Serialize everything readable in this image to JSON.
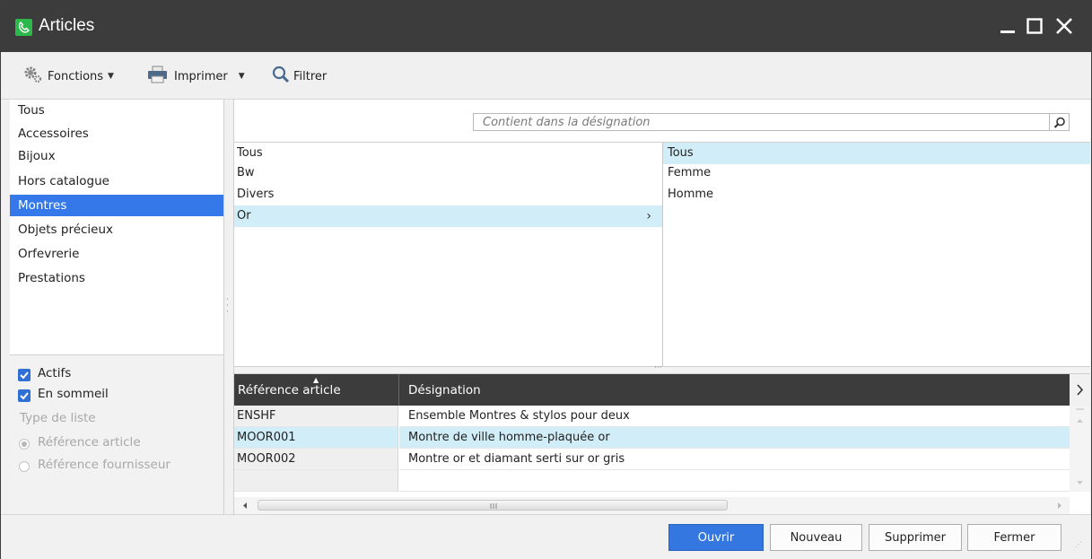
{
  "window": {
    "title": "Articles"
  },
  "toolbar": {
    "fonctions_label": "Fonctions",
    "imprimer_label": "Imprimer",
    "filtrer_label": "Filtrer"
  },
  "categories": [
    "Tous",
    "Accessoires",
    "Bijoux",
    "Hors catalogue",
    "Montres",
    "Objets précieux",
    "Orfevrerie",
    "Prestations"
  ],
  "selected_category": "Montres",
  "options": {
    "actifs_label": "Actifs",
    "actifs_checked": true,
    "en_sommeil_label": "En sommeil",
    "en_sommeil_checked": true,
    "type_liste_label": "Type de liste",
    "radio_ref_article": "Référence article",
    "radio_ref_fournisseur": "Référence fournisseur"
  },
  "search": {
    "placeholder": "Contient dans la désignation"
  },
  "list_left": [
    "Tous",
    "Bw",
    "Divers",
    "Or"
  ],
  "list_right": [
    "Tous",
    "Femme",
    "Homme"
  ],
  "grid": {
    "columns": [
      "Référence article",
      "Désignation"
    ],
    "rows": [
      {
        "ref": "ENSHF",
        "designation": "Ensemble Montres & stylos pour deux"
      },
      {
        "ref": "MOOR001",
        "designation": "Montre de ville homme-plaquée or"
      },
      {
        "ref": "MOOR002",
        "designation": "Montre or et diamant serti sur or gris"
      }
    ]
  },
  "footer": {
    "ouvrir": "Ouvrir",
    "nouveau": "Nouveau",
    "supprimer": "Supprimer",
    "fermer": "Fermer"
  },
  "colors": {
    "title_bar": "#3c3c3c",
    "accent": "#3478ea",
    "row_highlight": "#d1edf7",
    "app_icon": "#2cb84a"
  }
}
